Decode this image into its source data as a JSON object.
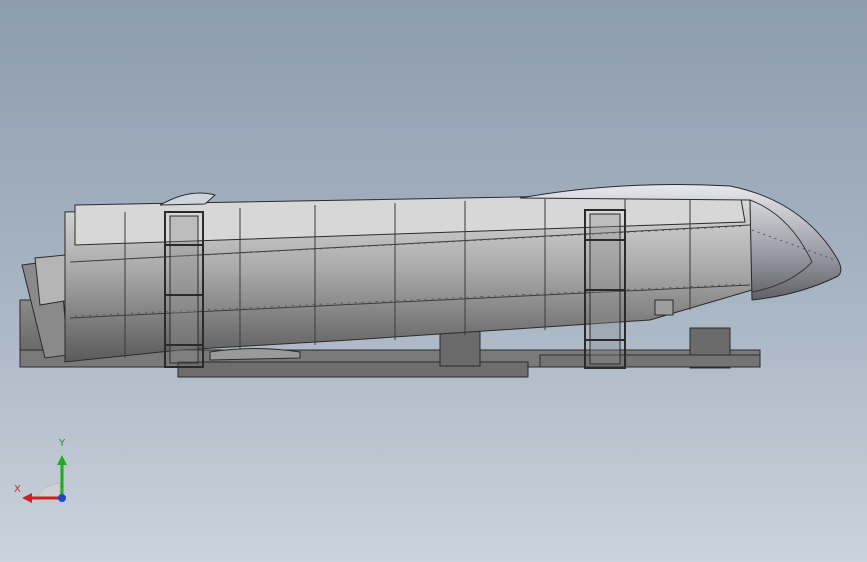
{
  "viewport": {
    "background_top": "#8d9cae",
    "background_bottom": "#cbd3dc"
  },
  "model": {
    "fill_light": "#cfcfcf",
    "fill_dark": "#5e5e5e",
    "edge_color": "#2a2a2a"
  },
  "triad": {
    "y_label": "Y",
    "x_label": "X",
    "y_color": "#22aa22",
    "x_color": "#cc2222",
    "z_color": "#2244cc"
  }
}
